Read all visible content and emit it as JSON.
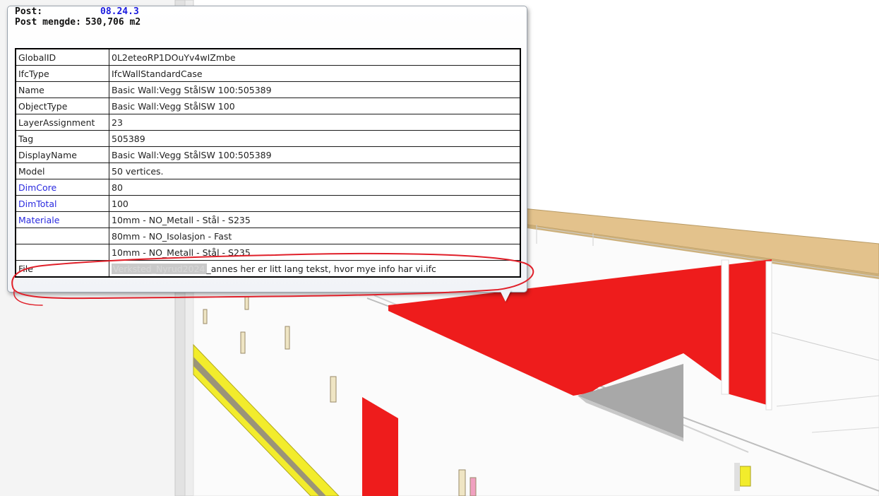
{
  "tooltip": {
    "post_label": "Post:",
    "post_value": "08.24.3",
    "mengde_label": "Post mengde:",
    "mengde_value": "530,706 m2"
  },
  "properties": [
    {
      "key": "GlobalID",
      "value": "0L2eteoRP1DOuYv4wIZmbe",
      "link": false
    },
    {
      "key": "IfcType",
      "value": "IfcWallStandardCase",
      "link": false
    },
    {
      "key": "Name",
      "value": "Basic Wall:Vegg StålSW 100:505389",
      "link": false
    },
    {
      "key": "ObjectType",
      "value": "Basic Wall:Vegg StålSW 100",
      "link": false
    },
    {
      "key": "LayerAssignment",
      "value": "23",
      "link": false
    },
    {
      "key": "Tag",
      "value": "505389",
      "link": false
    },
    {
      "key": "DisplayName",
      "value": "Basic Wall:Vegg StålSW 100:505389",
      "link": false
    },
    {
      "key": "Model",
      "value": "50 vertices.",
      "link": false
    },
    {
      "key": "DimCore",
      "value": "80",
      "link": true
    },
    {
      "key": "DimTotal",
      "value": "100",
      "link": true
    },
    {
      "key": "Materiale",
      "value": "10mm - NO_Metall - Stål - S235",
      "link": true
    },
    {
      "key": "",
      "value": "80mm - NO_Isolasjon - Fast",
      "link": false
    },
    {
      "key": "",
      "value": "10mm - NO_Metall - Stål - S235",
      "link": false
    }
  ],
  "file_row": {
    "key": "File",
    "value_blurred": "Verksted_Nyrud2024",
    "value": "_annes her er litt lang tekst, hvor mye info har vi.ifc"
  },
  "colors": {
    "highlight_red": "#ee1c1c",
    "beam_tan": "#e3c28c",
    "rail_yellow": "#f2ec2c",
    "annotation_red": "#e0202a",
    "post_blue": "#1a1adf",
    "link_blue": "#2a2adf"
  }
}
